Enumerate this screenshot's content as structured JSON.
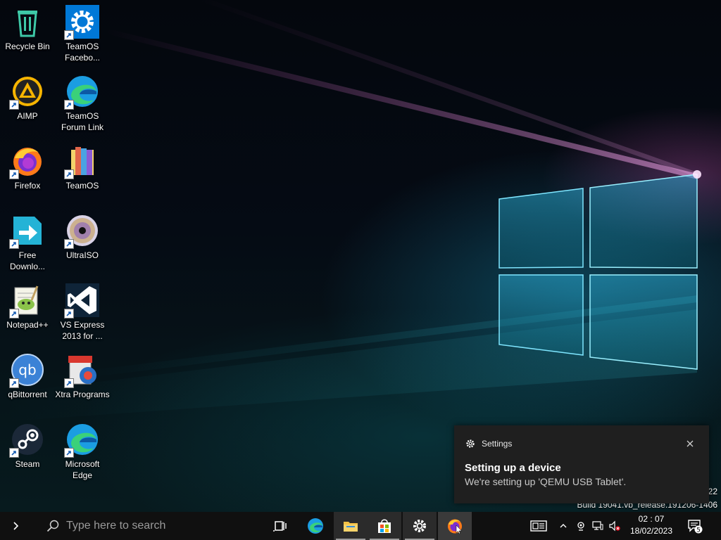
{
  "desktop": {
    "icons": [
      {
        "id": "recycle-bin",
        "label": "Recycle Bin",
        "icon": "recycle-bin-icon",
        "shortcut": false
      },
      {
        "id": "teamos-facebook",
        "label": "TeamOS Facebo...",
        "icon": "gear-icon",
        "shortcut": true
      },
      {
        "id": "aimp",
        "label": "AIMP",
        "icon": "aimp-icon",
        "shortcut": true
      },
      {
        "id": "teamos-forum-link",
        "label": "TeamOS Forum Link",
        "icon": "edge-icon",
        "shortcut": true
      },
      {
        "id": "firefox",
        "label": "Firefox",
        "icon": "firefox-icon",
        "shortcut": true
      },
      {
        "id": "teamos",
        "label": "TeamOS",
        "icon": "teamos-folder-icon",
        "shortcut": true
      },
      {
        "id": "free-download",
        "label": "Free Downlo...",
        "icon": "free-download-manager-icon",
        "shortcut": true
      },
      {
        "id": "ultraiso",
        "label": "UltraISO",
        "icon": "disc-icon",
        "shortcut": true
      },
      {
        "id": "notepadpp",
        "label": "Notepad++",
        "icon": "notepadpp-icon",
        "shortcut": true
      },
      {
        "id": "vs-express",
        "label": "VS Express 2013 for ...",
        "icon": "visual-studio-icon",
        "shortcut": true
      },
      {
        "id": "qbittorrent",
        "label": "qBittorrent",
        "icon": "qbittorrent-icon",
        "shortcut": true
      },
      {
        "id": "xtra-programs",
        "label": "Xtra Programs",
        "icon": "xtra-programs-icon",
        "shortcut": true
      },
      {
        "id": "steam",
        "label": "Steam",
        "icon": "steam-icon",
        "shortcut": true
      },
      {
        "id": "microsoft-edge",
        "label": "Microsoft Edge",
        "icon": "edge-icon",
        "shortcut": true
      }
    ]
  },
  "toast": {
    "app": "Settings",
    "title": "Setting up a device",
    "body": "We're setting up 'QEMU USB Tablet'."
  },
  "watermark": {
    "line1_fragment": "22",
    "build": "Build 19041.vb_release.191206-1406"
  },
  "taskbar": {
    "search_placeholder": "Type here to search",
    "clock_time": "02 : 07",
    "clock_date": "18/02/2023",
    "notification_count": "5"
  },
  "colors": {
    "taskbar": "#101010",
    "toast_bg": "#1f1f1f",
    "accent": "#0078d7"
  }
}
